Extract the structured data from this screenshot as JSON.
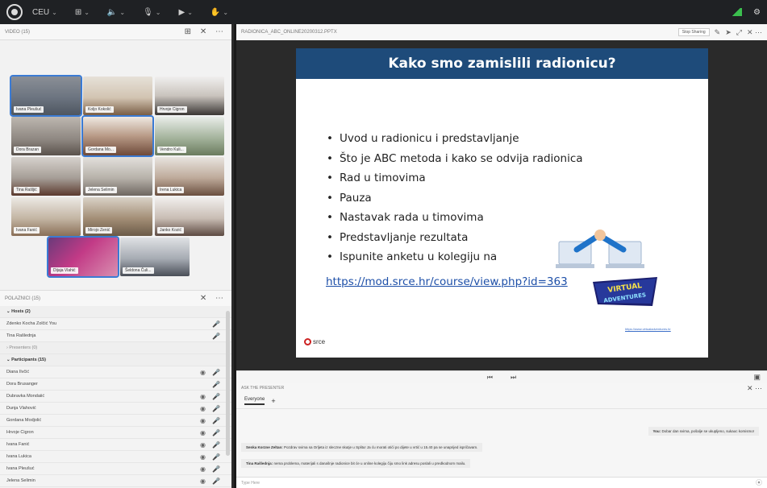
{
  "topbar": {
    "menus": [
      {
        "label": "CEU",
        "icon": "chevron-down-icon"
      },
      {
        "label": "",
        "icon": "grid-icon"
      },
      {
        "label": "",
        "icon": "speaker-icon"
      },
      {
        "label": "",
        "icon": "microphone-icon"
      },
      {
        "label": "",
        "icon": "camera-icon"
      },
      {
        "label": "",
        "icon": "hand-icon"
      }
    ]
  },
  "video_pod": {
    "title": "VIDEO (15)",
    "tiles": [
      {
        "name": "Ivana Pleušuć"
      },
      {
        "name": "Koljo Kokolić"
      },
      {
        "name": "Hrvoje Cigron"
      },
      {
        "name": "Dora Brazan"
      },
      {
        "name": "Gordana Mo..."
      },
      {
        "name": "Vendro Kuli..."
      },
      {
        "name": "Tina Rašljić"
      },
      {
        "name": "Jelena Selimin"
      },
      {
        "name": "Irena Lukica"
      },
      {
        "name": "Ivana Fanić"
      },
      {
        "name": "Mirojo Zenić"
      },
      {
        "name": "Janko Kozić"
      },
      {
        "name": "Dijaja Vlahić"
      },
      {
        "name": "Šeldona Čuli..."
      }
    ]
  },
  "participants": {
    "title": "POLAZNICI (15)",
    "groups": [
      {
        "label": "Hosts (2)",
        "rows": [
          {
            "name": "Zdenko Kocha Zolčić You",
            "icons": [
              "mic-icon"
            ]
          },
          {
            "name": "Tina Rašlednja",
            "icons": [
              "mic-icon"
            ]
          }
        ]
      },
      {
        "label": "Presenters (0)",
        "rows": []
      },
      {
        "label": "Participants (15)",
        "rows": [
          {
            "name": "Diana Ilvčić"
          },
          {
            "name": "Dora Brusanger"
          },
          {
            "name": "Dubravka Mondaiić"
          },
          {
            "name": "Dunja Vlahović"
          },
          {
            "name": "Gordana Modjolić"
          },
          {
            "name": "Hrvoje Cigron"
          },
          {
            "name": "Ivana Fanić"
          },
          {
            "name": "Ivana Lukica"
          },
          {
            "name": "Ivana Pleušuć"
          },
          {
            "name": "Jelena Selimin"
          }
        ]
      }
    ]
  },
  "share": {
    "file_name": "RADIONICA_ABC_ONLINE20200312.PPTX",
    "stop_label": "Stop Sharing",
    "slide": {
      "title": "Kako smo zamislili radionicu?",
      "bullets": [
        "Uvod u radionicu i predstavljanje",
        "Što je ABC metoda i   kako se odvija radionica",
        "Rad u timovima",
        "Pauza",
        "Nastavak rada u timovima",
        "Predstavljanje rezultata",
        "Ispunite anketu u kolegiju na"
      ],
      "link": "https://mod.srce.hr/course/view.php?id=363",
      "logo": "srce",
      "small_url": "https://www.virtualadventures.hr",
      "badge": "VIRTUAL ADVENTURES"
    }
  },
  "chat": {
    "title": "ASK THE PRESENTER",
    "tab": "Everyone",
    "messages": [
      {
        "author": "You:",
        "text": "Dobar dan svima, pošalje se ukupljeno, sukaoc komismo!"
      },
      {
        "author": "Senka Korzne Zeltan:",
        "text": "Pozdrav svima sa Orljeta iz sleczne skutje u Splitu! Ja ću morati otići po dijete u vrtić u 15.40 pa se unaprijed ispričavam."
      },
      {
        "author": "Tina Rašlednja:",
        "text": "nema problema, materijali s današnje radionice bit će u online kolegiju čiju smo link adresu poslali u predkodnom mailu."
      }
    ],
    "input_placeholder": "Type Here"
  }
}
